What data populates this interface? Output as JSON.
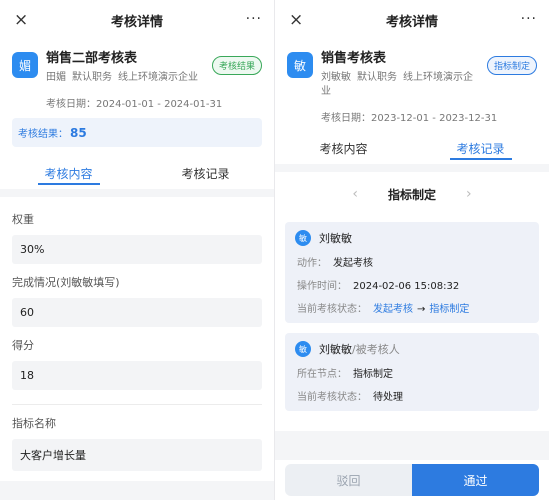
{
  "left": {
    "topbar": {
      "title": "考核详情",
      "close_icon": "×",
      "more_icon": "···"
    },
    "card": {
      "avatar": "媚",
      "title": "销售二部考核表",
      "sub": [
        "田媚",
        "默认职务",
        "线上环境演示企业"
      ],
      "badge": "考核结果",
      "date": "考核日期：2024-01-01 - 2024-01-31",
      "result_label": "考核结果：",
      "result_value": "85"
    },
    "tabs": [
      "考核内容",
      "考核记录"
    ],
    "fields": [
      {
        "label": "权重",
        "value": "30%"
      },
      {
        "label": "完成情况(刘敏敏填写)",
        "value": "60"
      },
      {
        "label": "得分",
        "value": "18"
      },
      {
        "label": "指标名称",
        "value": "大客户增长量"
      }
    ]
  },
  "right": {
    "topbar": {
      "title": "考核详情",
      "close_icon": "×",
      "more_icon": "···"
    },
    "card": {
      "avatar": "敏",
      "title": "销售考核表",
      "sub": [
        "刘敏敏",
        "默认职务",
        "线上环境演示企业"
      ],
      "badge": "指标制定",
      "date": "考核日期：2023-12-01 - 2023-12-31"
    },
    "tabs": [
      "考核内容",
      "考核记录"
    ],
    "pager": {
      "prev": "‹",
      "title": "指标制定",
      "next": "›"
    },
    "timeline": [
      {
        "avatar": "敏",
        "name": "刘敏敏",
        "action_label": "动作：",
        "action": "发起考核",
        "time_label": "操作时间：",
        "time": "2024-02-06 15:08:32",
        "status_label": "当前考核状态：",
        "status_from": "发起考核",
        "arrow": "→",
        "status_to": "指标制定"
      },
      {
        "avatar": "敏",
        "name": "刘敏敏",
        "role": "/被考核人",
        "node_label": "所在节点：",
        "node": "指标制定",
        "status_label": "当前考核状态：",
        "status": "待处理"
      }
    ],
    "buttons": {
      "reject": "驳回",
      "pass": "通过"
    }
  },
  "colors": {
    "accent": "#2d7be0",
    "avatar": "#2d8cf0",
    "badge_green": "#3aa85a"
  }
}
